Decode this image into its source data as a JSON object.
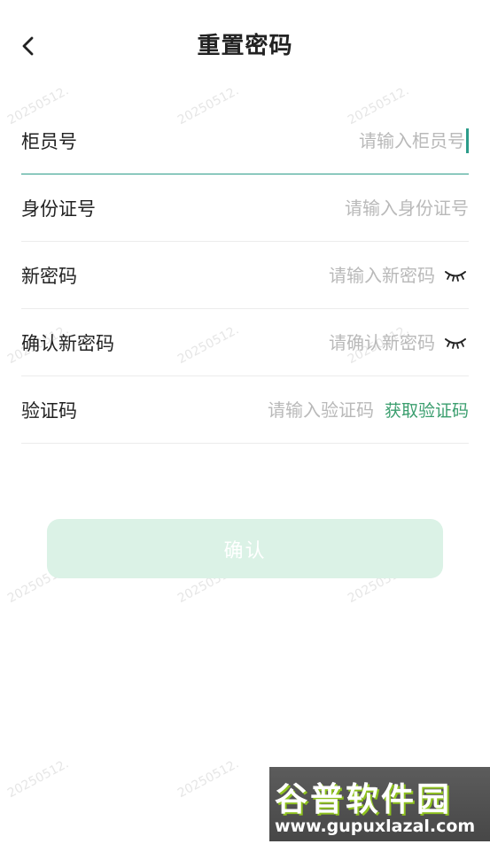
{
  "header": {
    "title": "重置密码"
  },
  "form": {
    "teller_no": {
      "label": "柜员号",
      "placeholder": "请输入柜员号"
    },
    "id_card": {
      "label": "身份证号",
      "placeholder": "请输入身份证号"
    },
    "new_password": {
      "label": "新密码",
      "placeholder": "请输入新密码"
    },
    "confirm_password": {
      "label": "确认新密码",
      "placeholder": "请确认新密码"
    },
    "verify_code": {
      "label": "验证码",
      "placeholder": "请输入验证码",
      "action": "获取验证码"
    }
  },
  "confirm_button": {
    "label": "确认"
  },
  "watermark": {
    "text": "20250512."
  },
  "logo": {
    "name": "谷普软件园",
    "url": "www.gupuxlazal.com"
  },
  "icons": {
    "back": "chevron-left-icon",
    "password_toggle": "eye-closed-icon"
  },
  "colors": {
    "accent": "#2c9c8a",
    "link": "#3a9e6e",
    "button_disabled_bg": "#dbf2e6",
    "placeholder": "#b9b9b9"
  }
}
